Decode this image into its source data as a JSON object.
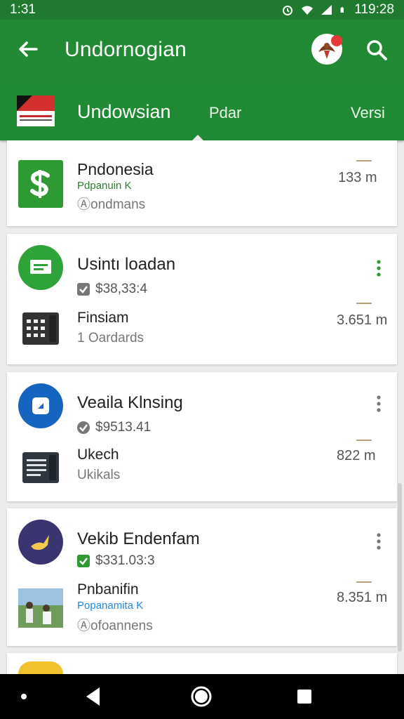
{
  "status": {
    "time_left": "1:31",
    "time_right": "119:28"
  },
  "appbar": {
    "title": "Undornogian"
  },
  "tabs": [
    {
      "label": "Undowsian"
    },
    {
      "label": "Pdar"
    },
    {
      "label": "Versi"
    }
  ],
  "cards": [
    {
      "title": "Pndonesia",
      "subtitle": "Pdpanuin     K",
      "detail": "Ⓐondmans",
      "meta": "133 m"
    },
    {
      "title": "Usintı loadan",
      "price": "$38,33:4",
      "sub_title": "Finsiam",
      "sub_detail": "1 Oardards",
      "meta": "3.651 m"
    },
    {
      "title": "Veaila Klnsing",
      "price": "$9513.41",
      "sub_title": "Ukech",
      "sub_detail": "Ukikals",
      "meta": "822 m"
    },
    {
      "title": "Vekib Endenfam",
      "price": "$331.03:3",
      "sub_title": "Pnbanifin",
      "sub_green": "Popanamita   K",
      "sub_detail": "Ⓐofoannens",
      "meta": "8.351 m"
    }
  ],
  "colors": {
    "primary": "#228a34",
    "accent_red": "#e53935"
  }
}
